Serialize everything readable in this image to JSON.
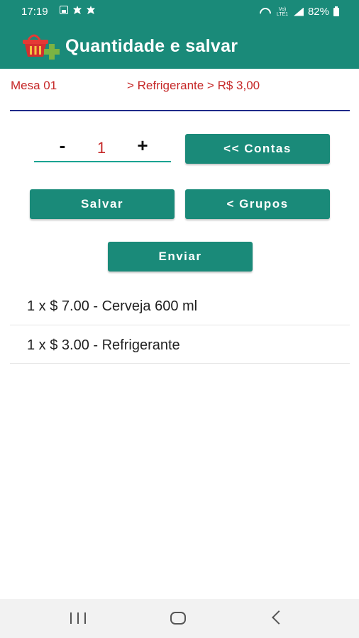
{
  "status_bar": {
    "time": "17:19",
    "volte_text": "Vo) LTE1",
    "battery": "82%"
  },
  "app_bar": {
    "title": "Quantidade e salvar",
    "logo_icon": "basket-plus-icon"
  },
  "breadcrumb": {
    "table": "Mesa 01",
    "path": "> Refrigerante > R$ 3,00"
  },
  "quantity": {
    "minus_label": "-",
    "value": "1",
    "plus_label": "+"
  },
  "buttons": {
    "contas": "<< Contas",
    "salvar": "Salvar",
    "grupos": "< Grupos",
    "enviar": "Enviar"
  },
  "items": [
    "1 x $ 7.00 - Cerveja 600 ml",
    "1 x $ 3.00 - Refrigerante"
  ],
  "colors": {
    "primary": "#1a8a79",
    "accent_red": "#c62828",
    "divider": "#1f2a8a"
  },
  "nav_bar": {
    "icons": [
      "recent-apps-icon",
      "home-icon",
      "back-icon"
    ]
  }
}
